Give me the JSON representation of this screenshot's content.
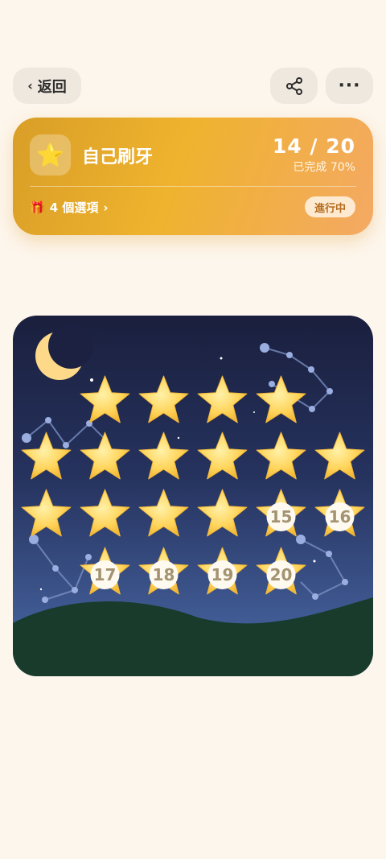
{
  "header": {
    "back_label": "返回",
    "back_icon": "chevron-left-icon",
    "share_icon": "share-icon",
    "more_icon": "more-horizontal-icon",
    "more_glyph": "···"
  },
  "task": {
    "icon": "⭐",
    "title": "自己刷牙",
    "progress": "14 / 20",
    "completed_text": "已完成 70%",
    "completed_fraction": 0.7,
    "options_icon": "🎁",
    "options_label": "4 個選項",
    "options_chevron": "›",
    "status": "進行中"
  },
  "stars": {
    "earned_count": 14,
    "total": 20,
    "rows": [
      [
        {
          "earned": true
        },
        {
          "earned": true
        },
        {
          "earned": true
        },
        {
          "earned": true
        }
      ],
      [
        {
          "earned": true
        },
        {
          "earned": true
        },
        {
          "earned": true
        },
        {
          "earned": true
        },
        {
          "earned": true
        },
        {
          "earned": true
        }
      ],
      [
        {
          "earned": true
        },
        {
          "earned": true
        },
        {
          "earned": true
        },
        {
          "earned": true
        },
        {
          "earned": false,
          "label": "15"
        },
        {
          "earned": false,
          "label": "16"
        }
      ],
      [
        {
          "earned": false,
          "label": "17"
        },
        {
          "earned": false,
          "label": "18"
        },
        {
          "earned": false,
          "label": "19"
        },
        {
          "earned": false,
          "label": "20"
        }
      ]
    ]
  },
  "colors": {
    "background": "#fdf6ec",
    "card_gradient_start": "#d89e27",
    "card_gradient_end": "#f4a964",
    "sky_top": "#1a1f3d",
    "sky_bottom": "#4a6aa8",
    "hill": "#183b2c",
    "star_fill": "#ffd45a",
    "moon": "#ffd98a"
  }
}
